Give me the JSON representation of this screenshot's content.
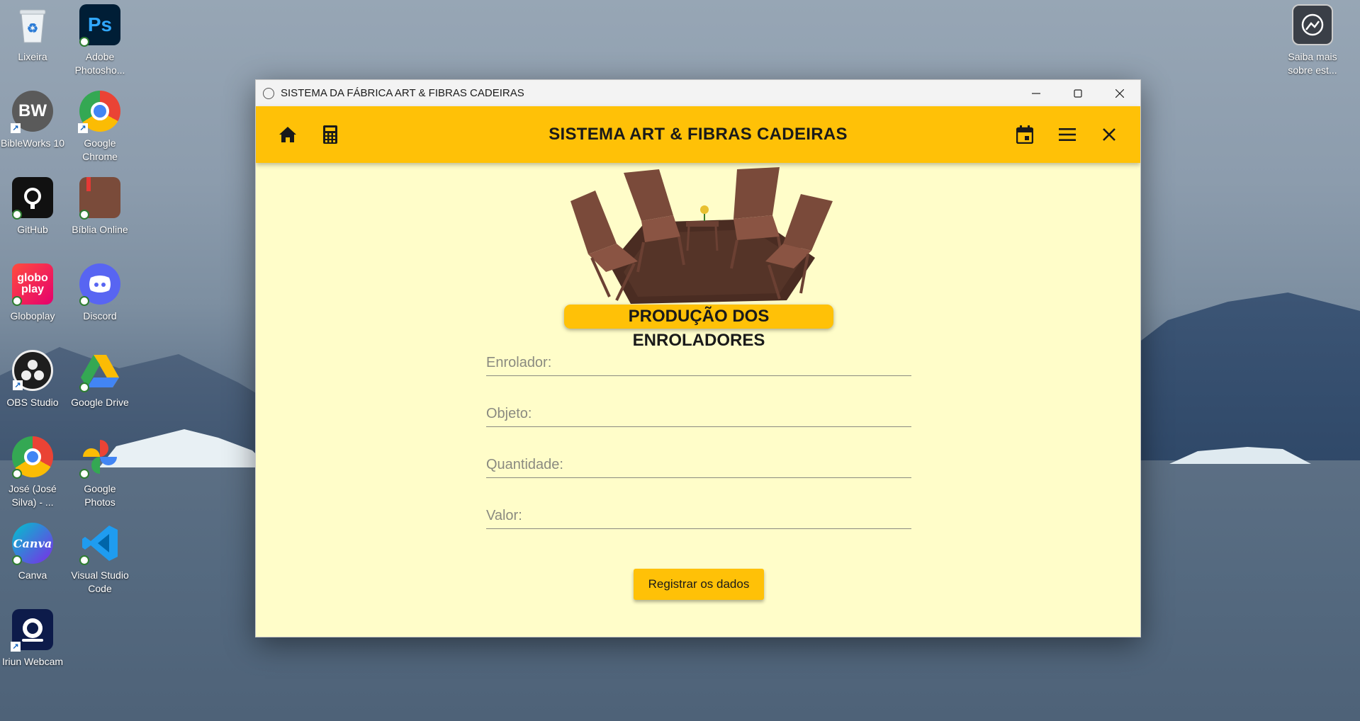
{
  "desktop": {
    "icons": [
      {
        "label": "Lixeira",
        "icon": "recycle-bin-icon"
      },
      {
        "label": "Adobe Photosho...",
        "icon": "photoshop-icon",
        "badge": "Ps"
      },
      {
        "label": "BibleWorks 10",
        "icon": "bibleworks-icon",
        "badge": "BW"
      },
      {
        "label": "Google Chrome",
        "icon": "chrome-icon"
      },
      {
        "label": "GitHub",
        "icon": "github-icon"
      },
      {
        "label": "Bíblia Online",
        "icon": "bible-icon"
      },
      {
        "label": "Globoplay",
        "icon": "globoplay-icon",
        "badge": "globo play"
      },
      {
        "label": "Discord",
        "icon": "discord-icon"
      },
      {
        "label": "OBS Studio",
        "icon": "obs-icon"
      },
      {
        "label": "Google Drive",
        "icon": "google-drive-icon"
      },
      {
        "label": "José (José Silva) - ...",
        "icon": "chrome-profile-icon"
      },
      {
        "label": "Google Photos",
        "icon": "google-photos-icon"
      },
      {
        "label": "Canva",
        "icon": "canva-icon",
        "badge": "Canva"
      },
      {
        "label": "Visual Studio Code",
        "icon": "vscode-icon"
      },
      {
        "label": "Iriun Webcam",
        "icon": "webcam-icon"
      },
      {
        "label": "Saiba mais sobre est...",
        "icon": "spotlight-icon"
      }
    ]
  },
  "window": {
    "title": "SISTEMA DA FÁBRICA ART & FIBRAS CADEIRAS",
    "controls": [
      "minimize",
      "maximize",
      "close"
    ]
  },
  "appbar": {
    "title": "SISTEMA ART & FIBRAS CADEIRAS",
    "left_icons": [
      "home-icon",
      "calculator-icon"
    ],
    "right_icons": [
      "calendar-icon",
      "menu-icon",
      "close-icon"
    ]
  },
  "form": {
    "heading": "PRODUÇÃO DOS ENROLADORES",
    "fields": {
      "enrolador": {
        "placeholder": "Enrolador:",
        "value": ""
      },
      "objeto": {
        "placeholder": "Objeto:",
        "value": ""
      },
      "quantidade": {
        "placeholder": "Quantidade:",
        "value": ""
      },
      "valor": {
        "placeholder": "Valor:",
        "value": ""
      }
    },
    "submit_label": "Registrar os dados"
  },
  "colors": {
    "accent": "#ffc107",
    "content_bg": "#fffdc9",
    "chair": "#7a4a3a",
    "rug": "#4a2c22"
  }
}
